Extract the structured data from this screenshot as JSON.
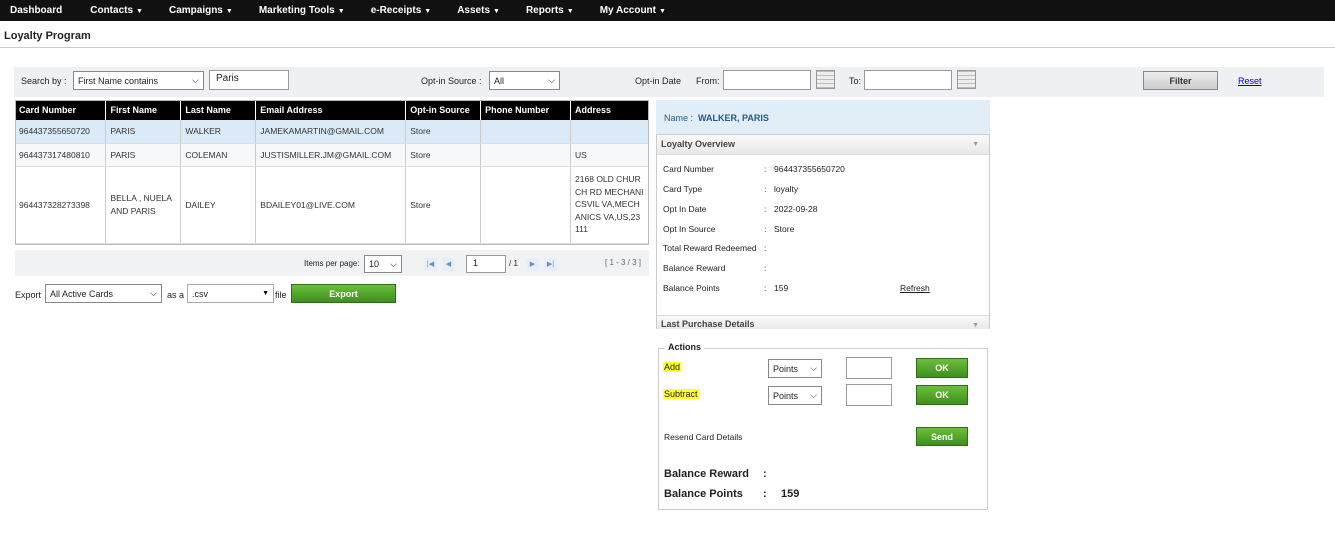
{
  "nav": [
    {
      "label": "Dashboard",
      "caret": ""
    },
    {
      "label": "Contacts",
      "caret": "▼"
    },
    {
      "label": "Campaigns",
      "caret": "▼"
    },
    {
      "label": "Marketing Tools",
      "caret": "▼"
    },
    {
      "label": "e-Receipts",
      "caret": "▼"
    },
    {
      "label": "Assets",
      "caret": "▼"
    },
    {
      "label": "Reports",
      "caret": "▼"
    },
    {
      "label": "My Account",
      "caret": "▼"
    }
  ],
  "page_title": "Loyalty Program",
  "filter": {
    "search_by_label": "Search by :",
    "search_by_value": "First Name contains",
    "search_text": "Paris",
    "optin_source_label": "Opt-in Source :",
    "optin_source_value": "All",
    "optin_date_label": "Opt-in Date",
    "from_label": "From:",
    "to_label": "To:",
    "filter_button": "Filter",
    "reset_link": "Reset"
  },
  "table": {
    "headers": [
      "Card Number",
      "First Name",
      "Last Name",
      "Email Address",
      "Opt-in Source",
      "Phone Number",
      "Address"
    ],
    "rows": [
      [
        "964437355650720",
        "PARIS",
        "WALKER",
        "JAMEKAMARTIN@GMAIL.COM",
        "Store",
        "",
        ""
      ],
      [
        "964437317480810",
        "PARIS",
        "COLEMAN",
        "JUSTISMILLER.JM@GMAIL.COM",
        "Store",
        "",
        "US"
      ],
      [
        "964437328273398",
        "BELLA , NUELA AND PARIS",
        "DAILEY",
        "BDAILEY01@LIVE.COM",
        "Store",
        "",
        "2168 OLD CHURCH RD MECHANICSVIL VA,MECHANICS VA,US,23111"
      ]
    ]
  },
  "pager": {
    "items_per_page_label": "Items per page:",
    "items_per_page": "10",
    "page": "1",
    "of_pages": "/ 1",
    "range": "[ 1 - 3 / 3 ]"
  },
  "export": {
    "label": "Export",
    "cards_value": "All Active Cards",
    "as_a": "as a",
    "format_value": ".csv",
    "file": "file",
    "button": "Export"
  },
  "detail": {
    "name_label": "Name :",
    "name_value": "WALKER, PARIS",
    "overview_title": "Loyalty Overview",
    "fields": [
      {
        "label": "Card Number",
        "value": "964437355650720"
      },
      {
        "label": "Card Type",
        "value": "loyalty"
      },
      {
        "label": "Opt In Date",
        "value": "2022-09-28"
      },
      {
        "label": "Opt In Source",
        "value": "Store"
      },
      {
        "label": "Total Reward Redeemed",
        "value": ""
      },
      {
        "label": "Balance Reward",
        "value": ""
      },
      {
        "label": "Balance Points",
        "value": "159"
      }
    ],
    "refresh_link": "Refresh",
    "last_purchase_title": "Last Purchase Details"
  },
  "actions": {
    "legend": "Actions",
    "add_label": "Add",
    "subtract_label": "Subtract",
    "unit_value": "Points",
    "ok_button": "OK",
    "resend_label": "Resend Card Details",
    "send_button": "Send",
    "balance_reward_label": "Balance Reward",
    "balance_reward_value": "",
    "balance_points_label": "Balance Points",
    "balance_points_value": "159"
  },
  "colors": {
    "nav_bg": "#111111",
    "header_bg": "#000000",
    "selected_row": "#dbeaf7",
    "green_button": "#4fa52a",
    "highlight": "#ffff33",
    "name_bar": "#e2eef7"
  }
}
